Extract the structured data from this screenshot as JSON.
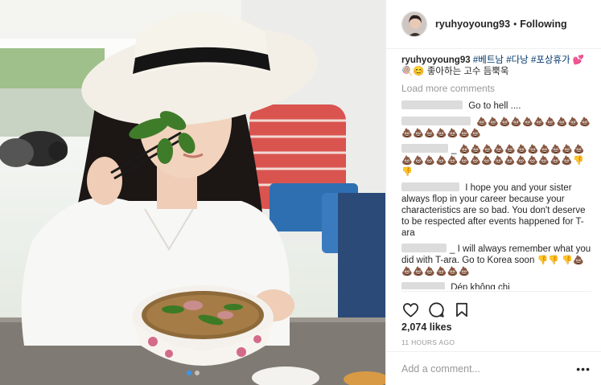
{
  "post": {
    "image_alt": "Photo by ryuhyoyoung93",
    "carousel": {
      "count": 2,
      "active_index": 0
    }
  },
  "header": {
    "username": "ryuhyoyoung93",
    "separator": "•",
    "follow_label": "Following"
  },
  "caption": {
    "username": "ryuhyoyoung93",
    "hashtags": [
      "#베트남",
      "#다낭",
      "#포상휴가"
    ],
    "heart_emoji": "💕",
    "line2": "🍭😊 좋아하는 고수 듬뿍욱"
  },
  "load_more_label": "Load more comments",
  "comments": [
    {
      "user_hidden": true,
      "text": "Go to hell ...."
    },
    {
      "user_hidden": true,
      "text": "",
      "emoji_run": "💩💩💩💩💩💩💩💩💩💩💩💩💩💩💩💩💩"
    },
    {
      "user_hidden": true,
      "user_suffix": "_",
      "text": "",
      "emoji_run": "💩💩💩💩💩💩💩💩💩💩💩💩💩💩💩💩💩💩💩💩💩💩💩💩💩💩",
      "trailing": "👎👎"
    },
    {
      "user_hidden": true,
      "text": "I hope you and your sister always flop in your career because your characteristics are so bad. You don't deserve to be respected after events happened for T-ara"
    },
    {
      "user_hidden": true,
      "user_suffix": "_",
      "text": "I will always remember what you did with T-ara. Go to Korea soon",
      "trailing": "👎👎",
      "after": "👎💩💩💩💩💩💩💩"
    },
    {
      "user_hidden": true,
      "text": "Dép không chị"
    }
  ],
  "actions": {
    "like_icon": "heart-icon",
    "comment_icon": "comment-icon",
    "save_icon": "bookmark-icon"
  },
  "likes_text": "2,074 likes",
  "time_ago": "11 HOURS AGO",
  "add_comment_placeholder": "Add a comment...",
  "more_label": "•••",
  "colors": {
    "hashtag": "#003569",
    "muted": "#999999",
    "text": "#262626",
    "border": "#efefef",
    "carousel_active": "#3897f0"
  }
}
